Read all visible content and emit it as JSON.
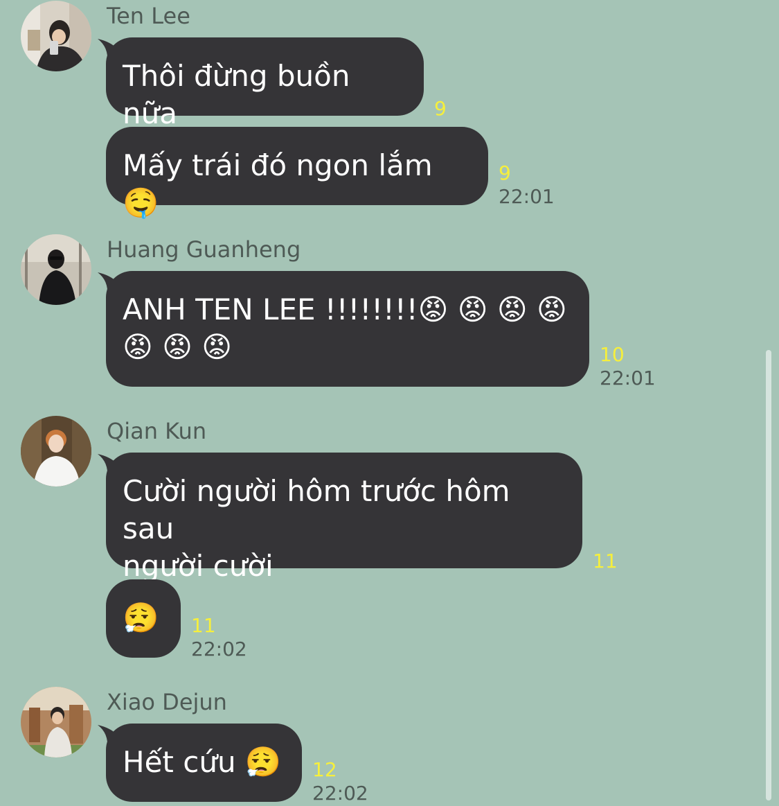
{
  "chat": {
    "messages": [
      {
        "sender": "Ten Lee",
        "text": "Thôi đừng buồn nữa",
        "read_count": "9",
        "time": ""
      },
      {
        "sender": "",
        "text": "Mấy trái đó ngon lắm 🤤",
        "read_count": "9",
        "time": "22:01"
      },
      {
        "sender": "Huang Guanheng",
        "text": "ANH TEN LEE !!!!!!!!😡 😡 😡 😡\n😡 😡 😡",
        "read_count": "10",
        "time": "22:01"
      },
      {
        "sender": "Qian Kun",
        "text": "Cười người hôm trước hôm sau\nngười cười",
        "read_count": "11",
        "time": ""
      },
      {
        "sender": "",
        "text": "😮‍💨",
        "read_count": "11",
        "time": "22:02"
      },
      {
        "sender": "Xiao Dejun",
        "text": "Hết cứu 😮‍💨",
        "read_count": "12",
        "time": "22:02"
      }
    ]
  },
  "colors": {
    "background": "#a5c4b6",
    "bubble": "#353437",
    "bubble_text": "#ffffff",
    "read_count": "#f6ef3c",
    "meta_text": "#4e5a55"
  }
}
